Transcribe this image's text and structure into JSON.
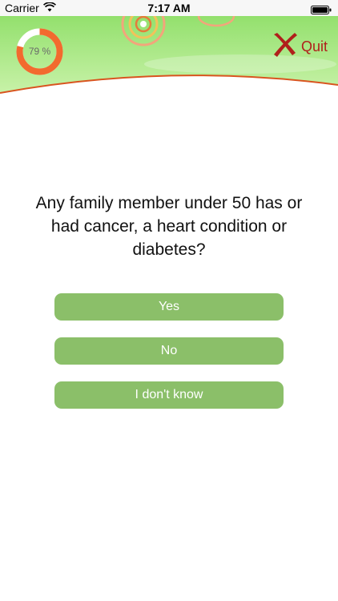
{
  "status_bar": {
    "carrier": "Carrier",
    "time": "7:17 AM",
    "icons": [
      "wifi-icon",
      "battery-icon"
    ]
  },
  "header": {
    "progress_percent": 79,
    "progress_label": "79 %",
    "quit_label": "Quit",
    "quit_icon": "x-mark-icon"
  },
  "question": {
    "text": "Any family member under 50 has or had cancer, a heart condition or diabetes?"
  },
  "answers": [
    {
      "label": "Yes"
    },
    {
      "label": "No"
    },
    {
      "label": "I don't know"
    }
  ],
  "colors": {
    "banner_green": "#a6e57f",
    "banner_edge": "#d9541f",
    "progress_fill": "#f26a2e",
    "progress_track": "#ffffff",
    "button_green": "#8bbf69",
    "quit_red": "#b0201b"
  }
}
